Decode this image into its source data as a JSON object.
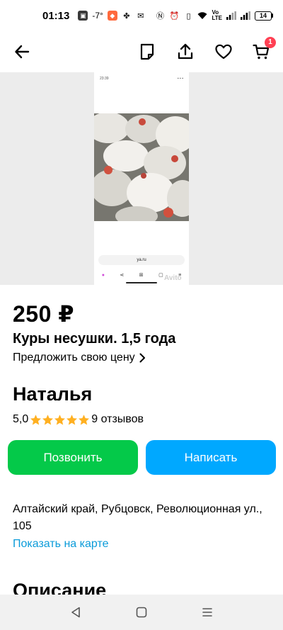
{
  "status_bar": {
    "time": "01:13",
    "temp": "-7",
    "battery": "14",
    "icons": [
      "app-icon",
      "weather-icon",
      "messenger-icon",
      "fan-icon",
      "mail-icon",
      "nfc-icon",
      "alarm-icon",
      "vibrate-icon",
      "wifi-icon",
      "volte-icon",
      "signal-icon",
      "signal-icon",
      "battery-icon"
    ]
  },
  "nav": {
    "back_icon": "arrow-left-icon",
    "note_icon": "note-icon",
    "share_icon": "share-icon",
    "favorite_icon": "heart-icon",
    "cart_icon": "cart-icon",
    "cart_count": "1"
  },
  "photo": {
    "shot_time": "23:39",
    "browser_url": "ya.ru",
    "watermark": "Avito"
  },
  "listing": {
    "price": "250 ₽",
    "title": "Куры несушки. 1,5 года",
    "offer_price": "Предложить свою цену"
  },
  "seller": {
    "name": "Наталья",
    "rating": "5,0",
    "stars": 5,
    "reviews": "9 отзывов"
  },
  "actions": {
    "call": "Позвонить",
    "write": "Написать"
  },
  "location": {
    "address": "Алтайский край, Рубцовск, Революционная ул., 105",
    "show_on_map": "Показать на карте"
  },
  "description": {
    "title": "Описание"
  },
  "colors": {
    "call_button": "#04c949",
    "write_button": "#00a8ff",
    "link": "#0a9bd9",
    "star": "#ffb021",
    "badge": "#ff4053"
  }
}
